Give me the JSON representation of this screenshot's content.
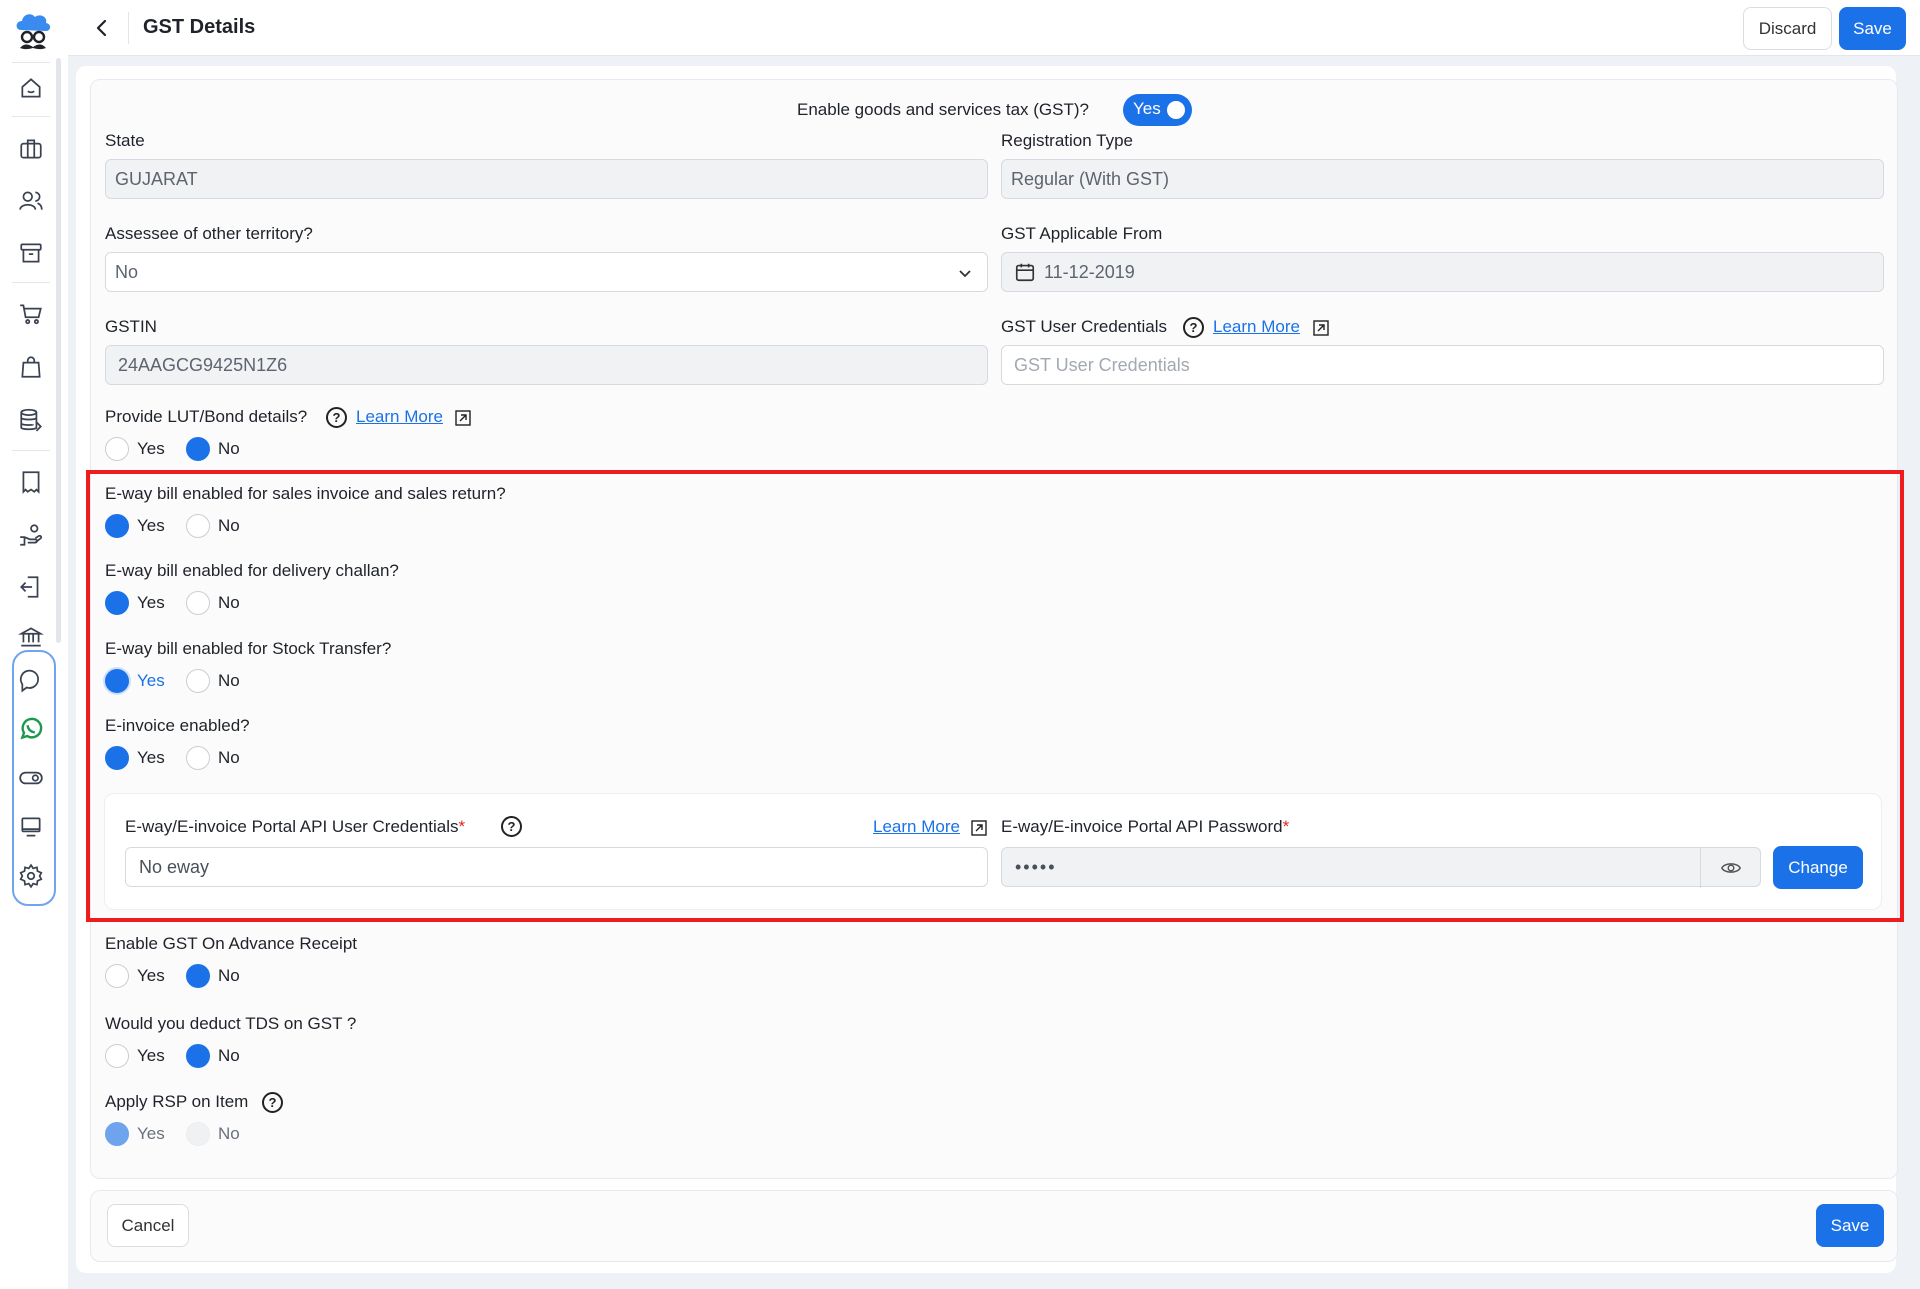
{
  "header": {
    "title": "GST Details",
    "discard_label": "Discard",
    "save_label": "Save"
  },
  "gst_toggle": {
    "question": "Enable goods and services tax (GST)?",
    "value": "Yes"
  },
  "fields": {
    "state": {
      "label": "State",
      "value": "GUJARAT"
    },
    "registration_type": {
      "label": "Registration Type",
      "value": "Regular (With GST)"
    },
    "assessee": {
      "label": "Assessee of other territory?",
      "value": "No"
    },
    "gst_applicable_from": {
      "label": "GST Applicable From",
      "value": "11-12-2019"
    },
    "gstin": {
      "label": "GSTIN",
      "value": "24AAGCG9425N1Z6"
    },
    "gst_user_credentials": {
      "label": "GST User Credentials",
      "placeholder": "GST User Credentials",
      "learn_more": "Learn More"
    }
  },
  "radios": {
    "lut_bond": {
      "label": "Provide LUT/Bond details?",
      "learn_more": "Learn More",
      "yes": "Yes",
      "no": "No",
      "selected": "No"
    },
    "eway_sales": {
      "label": "E-way bill enabled for sales invoice and sales return?",
      "yes": "Yes",
      "no": "No",
      "selected": "Yes"
    },
    "eway_challan": {
      "label": "E-way bill enabled for delivery challan?",
      "yes": "Yes",
      "no": "No",
      "selected": "Yes"
    },
    "eway_stock": {
      "label": "E-way bill enabled for Stock Transfer?",
      "yes": "Yes",
      "no": "No",
      "selected": "Yes"
    },
    "einvoice": {
      "label": "E-invoice enabled?",
      "yes": "Yes",
      "no": "No",
      "selected": "Yes"
    },
    "advance_receipt": {
      "label": "Enable GST On Advance Receipt",
      "yes": "Yes",
      "no": "No",
      "selected": "No"
    },
    "tds_on_gst": {
      "label": "Would you deduct TDS on GST ?",
      "yes": "Yes",
      "no": "No",
      "selected": "No"
    },
    "rsp_on_item": {
      "label": "Apply RSP on Item",
      "yes": "Yes",
      "no": "No",
      "selected": "Yes"
    }
  },
  "portal": {
    "user_label": "E-way/E-invoice Portal API User Credentials",
    "user_value": "No eway",
    "learn_more": "Learn More",
    "password_label": "E-way/E-invoice Portal API Password",
    "password_value": "•••••",
    "change_label": "Change",
    "required_mark": "*"
  },
  "footer": {
    "cancel_label": "Cancel",
    "save_label": "Save"
  },
  "colors": {
    "accent": "#1b72e8",
    "highlight": "#ee1c1c",
    "whatsapp": "#1c9a4c"
  },
  "sidebar_icons": [
    "home-icon",
    "briefcase-icon",
    "users-icon",
    "archive-icon",
    "cart-icon",
    "bag-icon",
    "database-icon",
    "receipt-icon",
    "hand-coins-icon",
    "return-icon",
    "bank-icon",
    "chat-icon",
    "whatsapp-icon",
    "toggle-icon",
    "monitor-icon",
    "gear-icon"
  ]
}
